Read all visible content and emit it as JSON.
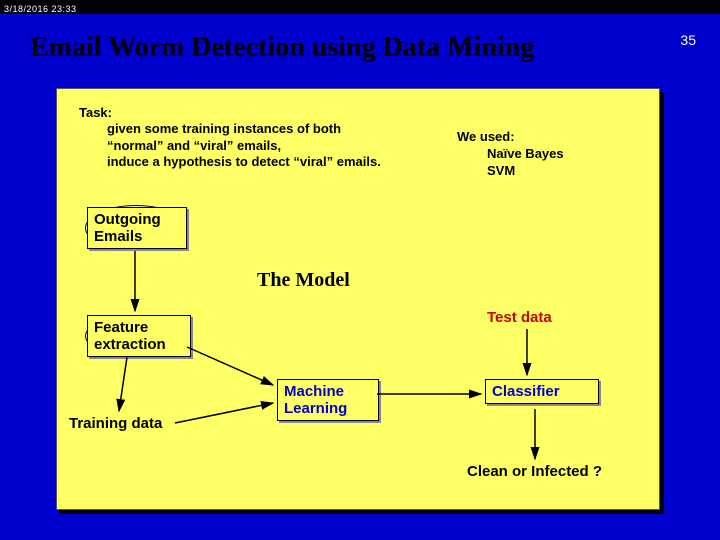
{
  "meta": {
    "timestamp": "3/18/2016  23:33",
    "page_number": "35"
  },
  "title": "Email Worm Detection using Data Mining",
  "task": {
    "heading": "Task:",
    "line1": "given some training instances of both",
    "line2": "“normal” and “viral” emails,",
    "line3": "induce a hypothesis to detect “viral” emails."
  },
  "used": {
    "heading": "We used:",
    "item1": "Naïve Bayes",
    "item2": "SVM"
  },
  "nodes": {
    "outgoing1": "Outgoing",
    "outgoing2": "Emails",
    "model": "The Model",
    "feature1": "Feature",
    "feature2": "extraction",
    "ml1": "Machine",
    "ml2": "Learning",
    "train": "Training data",
    "test": "Test data",
    "classifier": "Classifier",
    "clean": "Clean or Infected ?"
  }
}
